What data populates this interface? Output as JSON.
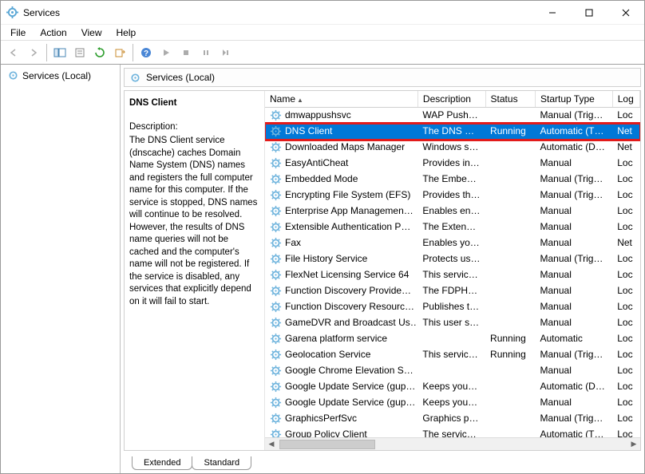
{
  "window": {
    "title": "Services"
  },
  "menu": {
    "file": "File",
    "action": "Action",
    "view": "View",
    "help": "Help"
  },
  "tree": {
    "root": "Services (Local)"
  },
  "header": {
    "label": "Services (Local)"
  },
  "detail": {
    "selected_name": "DNS Client",
    "description_label": "Description:",
    "description_text": "The DNS Client service (dnscache) caches Domain Name System (DNS) names and registers the full computer name for this computer. If the service is stopped, DNS names will continue to be resolved. However, the results of DNS name queries will not be cached and the computer's name will not be registered. If the service is disabled, any services that explicitly depend on it will fail to start."
  },
  "columns": {
    "name": "Name",
    "desc": "Description",
    "status": "Status",
    "startup": "Startup Type",
    "logon": "Log"
  },
  "tabs": {
    "extended": "Extended",
    "standard": "Standard"
  },
  "rows": [
    {
      "name": "dmwappushsvc",
      "desc": "WAP Push …",
      "status": "",
      "startup": "Manual (Trig…",
      "logon": "Loc"
    },
    {
      "name": "DNS Client",
      "desc": "The DNS Cli…",
      "status": "Running",
      "startup": "Automatic (T…",
      "logon": "Net",
      "selected": true,
      "highlight": true
    },
    {
      "name": "Downloaded Maps Manager",
      "desc": "Windows se…",
      "status": "",
      "startup": "Automatic (D…",
      "logon": "Net"
    },
    {
      "name": "EasyAntiCheat",
      "desc": "Provides int…",
      "status": "",
      "startup": "Manual",
      "logon": "Loc"
    },
    {
      "name": "Embedded Mode",
      "desc": "The Embed…",
      "status": "",
      "startup": "Manual (Trig…",
      "logon": "Loc"
    },
    {
      "name": "Encrypting File System (EFS)",
      "desc": "Provides th…",
      "status": "",
      "startup": "Manual (Trig…",
      "logon": "Loc"
    },
    {
      "name": "Enterprise App Managemen…",
      "desc": "Enables ent…",
      "status": "",
      "startup": "Manual",
      "logon": "Loc"
    },
    {
      "name": "Extensible Authentication P…",
      "desc": "The Extensi…",
      "status": "",
      "startup": "Manual",
      "logon": "Loc"
    },
    {
      "name": "Fax",
      "desc": "Enables you…",
      "status": "",
      "startup": "Manual",
      "logon": "Net"
    },
    {
      "name": "File History Service",
      "desc": "Protects use…",
      "status": "",
      "startup": "Manual (Trig…",
      "logon": "Loc"
    },
    {
      "name": "FlexNet Licensing Service 64",
      "desc": "This service …",
      "status": "",
      "startup": "Manual",
      "logon": "Loc"
    },
    {
      "name": "Function Discovery Provide…",
      "desc": "The FDPHO…",
      "status": "",
      "startup": "Manual",
      "logon": "Loc"
    },
    {
      "name": "Function Discovery Resourc…",
      "desc": "Publishes th…",
      "status": "",
      "startup": "Manual",
      "logon": "Loc"
    },
    {
      "name": "GameDVR and Broadcast Us…",
      "desc": "This user se…",
      "status": "",
      "startup": "Manual",
      "logon": "Loc"
    },
    {
      "name": "Garena platform service",
      "desc": "",
      "status": "Running",
      "startup": "Automatic",
      "logon": "Loc"
    },
    {
      "name": "Geolocation Service",
      "desc": "This service …",
      "status": "Running",
      "startup": "Manual (Trig…",
      "logon": "Loc"
    },
    {
      "name": "Google Chrome Elevation S…",
      "desc": "",
      "status": "",
      "startup": "Manual",
      "logon": "Loc"
    },
    {
      "name": "Google Update Service (gup…",
      "desc": "Keeps your …",
      "status": "",
      "startup": "Automatic (D…",
      "logon": "Loc"
    },
    {
      "name": "Google Update Service (gup…",
      "desc": "Keeps your …",
      "status": "",
      "startup": "Manual",
      "logon": "Loc"
    },
    {
      "name": "GraphicsPerfSvc",
      "desc": "Graphics pe…",
      "status": "",
      "startup": "Manual (Trig…",
      "logon": "Loc"
    },
    {
      "name": "Group Policy Client",
      "desc": "The service …",
      "status": "",
      "startup": "Automatic (T…",
      "logon": "Loc"
    }
  ]
}
